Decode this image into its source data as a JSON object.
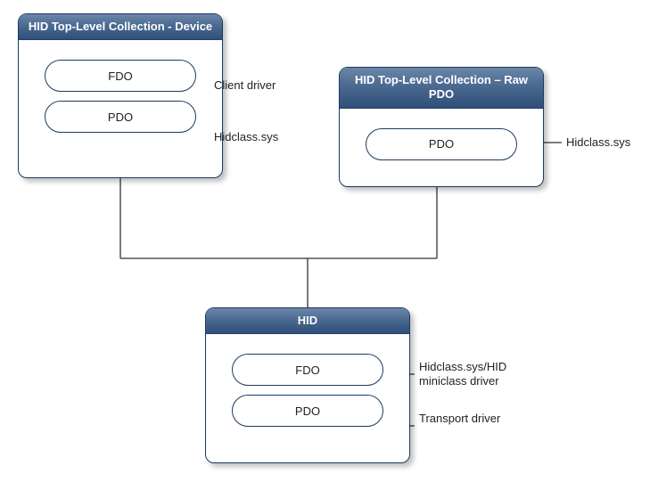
{
  "panels": {
    "device": {
      "title": "HID Top-Level Collection - Device",
      "fdo": "FDO",
      "pdo": "PDO"
    },
    "raw": {
      "title": "HID Top-Level Collection – Raw PDO",
      "pdo": "PDO"
    },
    "hid": {
      "title": "HID",
      "fdo": "FDO",
      "pdo": "PDO"
    }
  },
  "labels": {
    "clientDriver": "Client driver",
    "hidclass1": "Hidclass.sys",
    "hidclass2": "Hidclass.sys",
    "hidMini": "Hidclass.sys/HID miniclass driver",
    "transport": "Transport driver"
  }
}
